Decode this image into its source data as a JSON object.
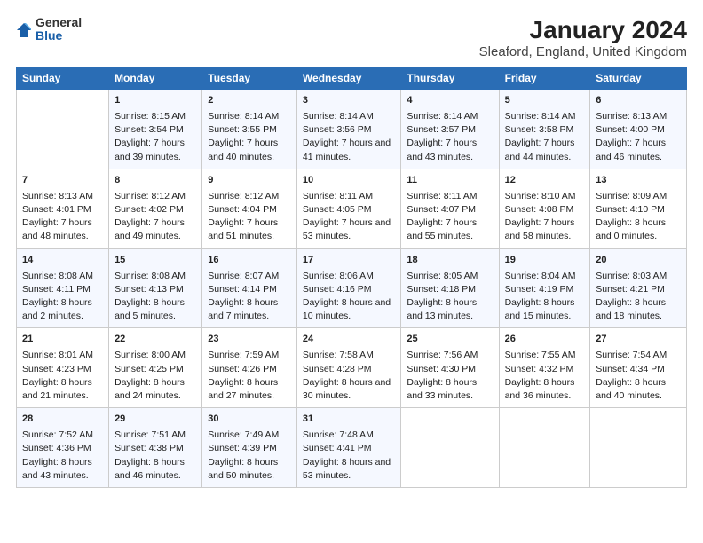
{
  "logo": {
    "general": "General",
    "blue": "Blue"
  },
  "title": "January 2024",
  "subtitle": "Sleaford, England, United Kingdom",
  "days": [
    "Sunday",
    "Monday",
    "Tuesday",
    "Wednesday",
    "Thursday",
    "Friday",
    "Saturday"
  ],
  "weeks": [
    [
      {
        "date": "",
        "sunrise": "",
        "sunset": "",
        "daylight": ""
      },
      {
        "date": "1",
        "sunrise": "Sunrise: 8:15 AM",
        "sunset": "Sunset: 3:54 PM",
        "daylight": "Daylight: 7 hours and 39 minutes."
      },
      {
        "date": "2",
        "sunrise": "Sunrise: 8:14 AM",
        "sunset": "Sunset: 3:55 PM",
        "daylight": "Daylight: 7 hours and 40 minutes."
      },
      {
        "date": "3",
        "sunrise": "Sunrise: 8:14 AM",
        "sunset": "Sunset: 3:56 PM",
        "daylight": "Daylight: 7 hours and 41 minutes."
      },
      {
        "date": "4",
        "sunrise": "Sunrise: 8:14 AM",
        "sunset": "Sunset: 3:57 PM",
        "daylight": "Daylight: 7 hours and 43 minutes."
      },
      {
        "date": "5",
        "sunrise": "Sunrise: 8:14 AM",
        "sunset": "Sunset: 3:58 PM",
        "daylight": "Daylight: 7 hours and 44 minutes."
      },
      {
        "date": "6",
        "sunrise": "Sunrise: 8:13 AM",
        "sunset": "Sunset: 4:00 PM",
        "daylight": "Daylight: 7 hours and 46 minutes."
      }
    ],
    [
      {
        "date": "7",
        "sunrise": "Sunrise: 8:13 AM",
        "sunset": "Sunset: 4:01 PM",
        "daylight": "Daylight: 7 hours and 48 minutes."
      },
      {
        "date": "8",
        "sunrise": "Sunrise: 8:12 AM",
        "sunset": "Sunset: 4:02 PM",
        "daylight": "Daylight: 7 hours and 49 minutes."
      },
      {
        "date": "9",
        "sunrise": "Sunrise: 8:12 AM",
        "sunset": "Sunset: 4:04 PM",
        "daylight": "Daylight: 7 hours and 51 minutes."
      },
      {
        "date": "10",
        "sunrise": "Sunrise: 8:11 AM",
        "sunset": "Sunset: 4:05 PM",
        "daylight": "Daylight: 7 hours and 53 minutes."
      },
      {
        "date": "11",
        "sunrise": "Sunrise: 8:11 AM",
        "sunset": "Sunset: 4:07 PM",
        "daylight": "Daylight: 7 hours and 55 minutes."
      },
      {
        "date": "12",
        "sunrise": "Sunrise: 8:10 AM",
        "sunset": "Sunset: 4:08 PM",
        "daylight": "Daylight: 7 hours and 58 minutes."
      },
      {
        "date": "13",
        "sunrise": "Sunrise: 8:09 AM",
        "sunset": "Sunset: 4:10 PM",
        "daylight": "Daylight: 8 hours and 0 minutes."
      }
    ],
    [
      {
        "date": "14",
        "sunrise": "Sunrise: 8:08 AM",
        "sunset": "Sunset: 4:11 PM",
        "daylight": "Daylight: 8 hours and 2 minutes."
      },
      {
        "date": "15",
        "sunrise": "Sunrise: 8:08 AM",
        "sunset": "Sunset: 4:13 PM",
        "daylight": "Daylight: 8 hours and 5 minutes."
      },
      {
        "date": "16",
        "sunrise": "Sunrise: 8:07 AM",
        "sunset": "Sunset: 4:14 PM",
        "daylight": "Daylight: 8 hours and 7 minutes."
      },
      {
        "date": "17",
        "sunrise": "Sunrise: 8:06 AM",
        "sunset": "Sunset: 4:16 PM",
        "daylight": "Daylight: 8 hours and 10 minutes."
      },
      {
        "date": "18",
        "sunrise": "Sunrise: 8:05 AM",
        "sunset": "Sunset: 4:18 PM",
        "daylight": "Daylight: 8 hours and 13 minutes."
      },
      {
        "date": "19",
        "sunrise": "Sunrise: 8:04 AM",
        "sunset": "Sunset: 4:19 PM",
        "daylight": "Daylight: 8 hours and 15 minutes."
      },
      {
        "date": "20",
        "sunrise": "Sunrise: 8:03 AM",
        "sunset": "Sunset: 4:21 PM",
        "daylight": "Daylight: 8 hours and 18 minutes."
      }
    ],
    [
      {
        "date": "21",
        "sunrise": "Sunrise: 8:01 AM",
        "sunset": "Sunset: 4:23 PM",
        "daylight": "Daylight: 8 hours and 21 minutes."
      },
      {
        "date": "22",
        "sunrise": "Sunrise: 8:00 AM",
        "sunset": "Sunset: 4:25 PM",
        "daylight": "Daylight: 8 hours and 24 minutes."
      },
      {
        "date": "23",
        "sunrise": "Sunrise: 7:59 AM",
        "sunset": "Sunset: 4:26 PM",
        "daylight": "Daylight: 8 hours and 27 minutes."
      },
      {
        "date": "24",
        "sunrise": "Sunrise: 7:58 AM",
        "sunset": "Sunset: 4:28 PM",
        "daylight": "Daylight: 8 hours and 30 minutes."
      },
      {
        "date": "25",
        "sunrise": "Sunrise: 7:56 AM",
        "sunset": "Sunset: 4:30 PM",
        "daylight": "Daylight: 8 hours and 33 minutes."
      },
      {
        "date": "26",
        "sunrise": "Sunrise: 7:55 AM",
        "sunset": "Sunset: 4:32 PM",
        "daylight": "Daylight: 8 hours and 36 minutes."
      },
      {
        "date": "27",
        "sunrise": "Sunrise: 7:54 AM",
        "sunset": "Sunset: 4:34 PM",
        "daylight": "Daylight: 8 hours and 40 minutes."
      }
    ],
    [
      {
        "date": "28",
        "sunrise": "Sunrise: 7:52 AM",
        "sunset": "Sunset: 4:36 PM",
        "daylight": "Daylight: 8 hours and 43 minutes."
      },
      {
        "date": "29",
        "sunrise": "Sunrise: 7:51 AM",
        "sunset": "Sunset: 4:38 PM",
        "daylight": "Daylight: 8 hours and 46 minutes."
      },
      {
        "date": "30",
        "sunrise": "Sunrise: 7:49 AM",
        "sunset": "Sunset: 4:39 PM",
        "daylight": "Daylight: 8 hours and 50 minutes."
      },
      {
        "date": "31",
        "sunrise": "Sunrise: 7:48 AM",
        "sunset": "Sunset: 4:41 PM",
        "daylight": "Daylight: 8 hours and 53 minutes."
      },
      {
        "date": "",
        "sunrise": "",
        "sunset": "",
        "daylight": ""
      },
      {
        "date": "",
        "sunrise": "",
        "sunset": "",
        "daylight": ""
      },
      {
        "date": "",
        "sunrise": "",
        "sunset": "",
        "daylight": ""
      }
    ]
  ]
}
